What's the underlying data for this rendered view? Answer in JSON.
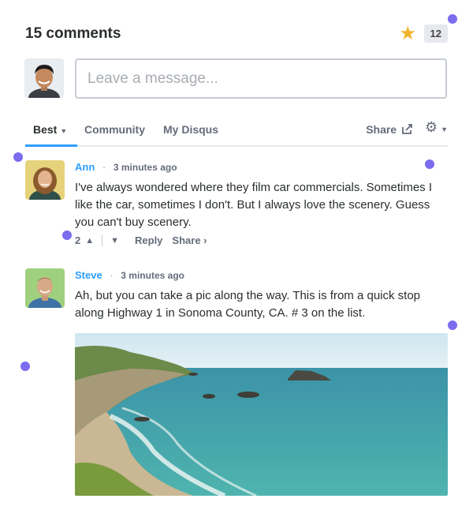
{
  "header": {
    "count_label": "15 comments",
    "star_count": "12"
  },
  "composer": {
    "placeholder": "Leave a message..."
  },
  "tabs": {
    "best": "Best",
    "community": "Community",
    "my_disqus": "My Disqus",
    "share": "Share"
  },
  "comments": [
    {
      "author": "Ann",
      "time": "3 minutes ago",
      "text": "I've always wondered where they film car commercials. Sometimes I like the car, sometimes I don't. But I always love the scenery. Guess you can't buy scenery.",
      "votes": "2",
      "reply": "Reply",
      "share": "Share ›"
    },
    {
      "author": "Steve",
      "time": "3 minutes ago",
      "text": "Ah, but you can take a pic along the way. This is from a quick stop along Highway 1 in Sonoma County, CA. # 3 on the list."
    }
  ],
  "icons": {
    "star": "star-icon",
    "share": "share-icon",
    "gear": "gear-icon",
    "upvote": "chevron-up-icon",
    "downvote": "chevron-down-icon"
  },
  "colors": {
    "accent": "#2e9fff",
    "star": "#f0b429",
    "marker": "#7b6cf0"
  }
}
